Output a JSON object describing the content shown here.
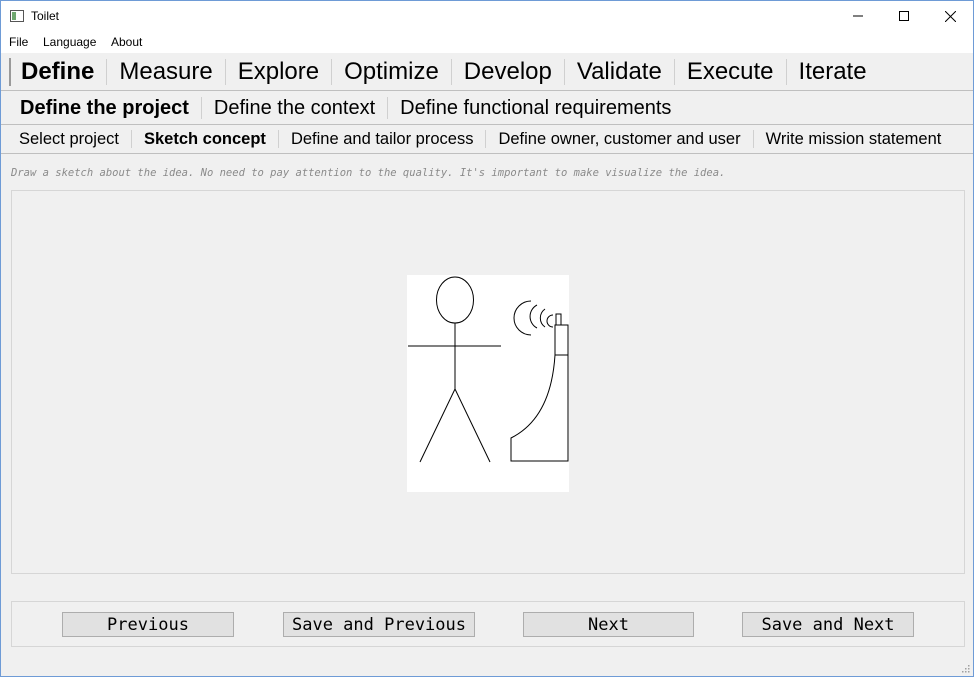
{
  "window": {
    "title": "Toilet"
  },
  "menu": [
    "File",
    "Language",
    "About"
  ],
  "phases": {
    "items": [
      "Define",
      "Measure",
      "Explore",
      "Optimize",
      "Develop",
      "Validate",
      "Execute",
      "Iterate"
    ],
    "active": "Define"
  },
  "subphases": {
    "items": [
      "Define the project",
      "Define the context",
      "Define functional requirements"
    ],
    "active": "Define the project"
  },
  "steps": {
    "items": [
      "Select project",
      "Sketch concept",
      "Define and tailor process",
      "Define owner, customer and user",
      "Write mission statement"
    ],
    "active": "Sketch concept"
  },
  "instruction": "Draw a sketch about the idea. No need to pay attention to the quality. It's important to make visualize the idea.",
  "buttons": {
    "previous": "Previous",
    "save_previous": "Save and Previous",
    "next": "Next",
    "save_next": "Save and Next"
  }
}
